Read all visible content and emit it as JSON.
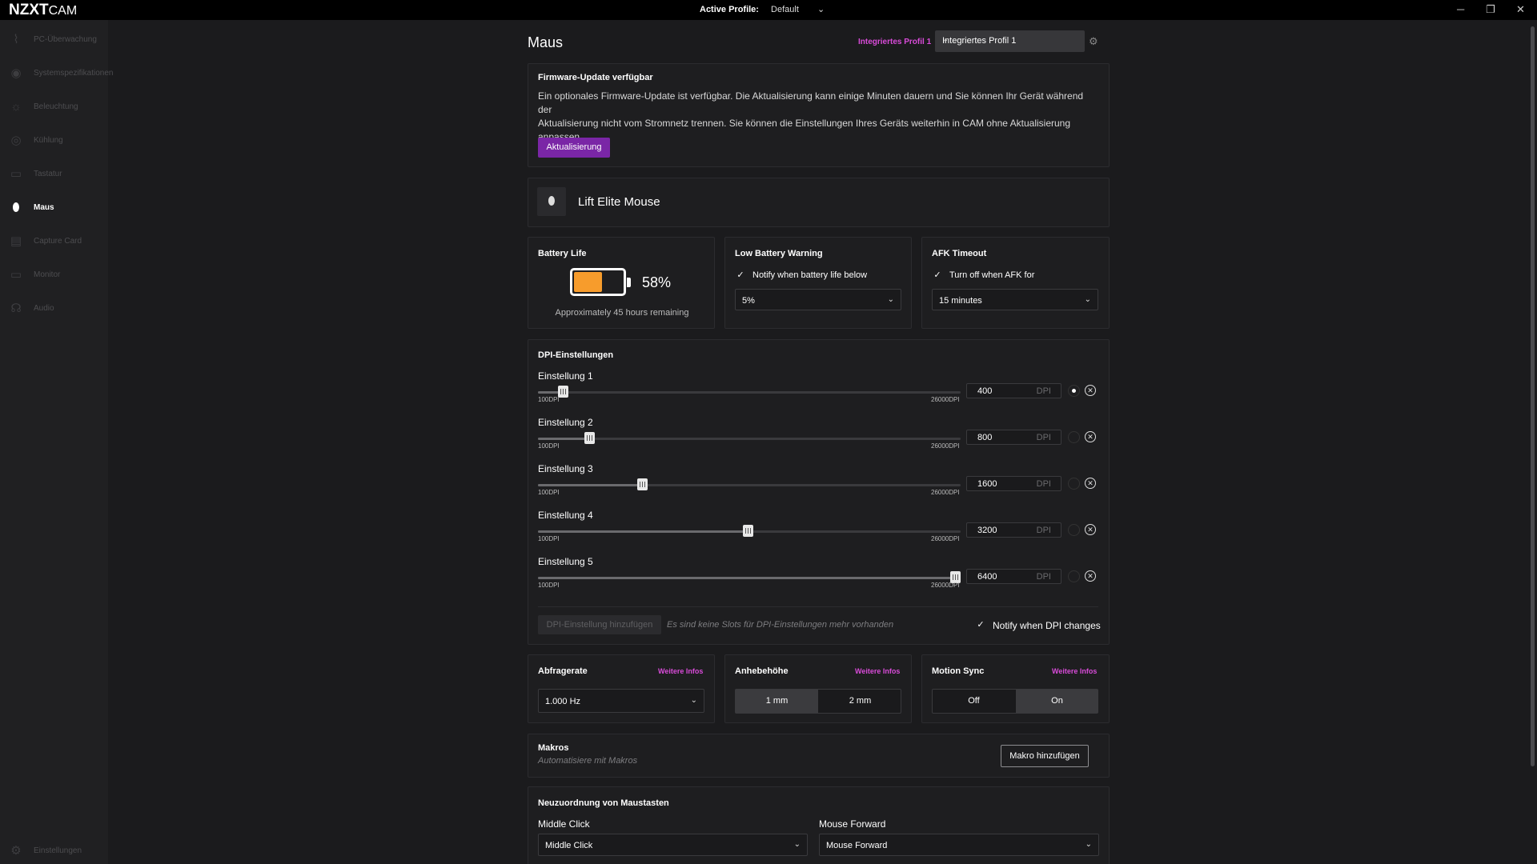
{
  "app": {
    "logo_main": "NZXT",
    "logo_sub": "CAM"
  },
  "titlebar": {
    "active_profile_label": "Active Profile:",
    "active_profile_value": "Default",
    "minimize": "─",
    "maximize": "❐",
    "close": "✕"
  },
  "sidebar": {
    "items": [
      {
        "label": "PC-Überwachung",
        "icon": "chart-line-icon",
        "glyph": "⌇"
      },
      {
        "label": "Systemspezifikationen",
        "icon": "eye-icon",
        "glyph": "◉"
      },
      {
        "label": "Beleuchtung",
        "icon": "sun-icon",
        "glyph": "☼"
      },
      {
        "label": "Kühlung",
        "icon": "fan-icon",
        "glyph": "◎"
      },
      {
        "label": "Tastatur",
        "icon": "keyboard-icon",
        "glyph": "▭"
      },
      {
        "label": "Maus",
        "icon": "mouse-icon",
        "glyph": "⬮"
      },
      {
        "label": "Capture Card",
        "icon": "capture-card-icon",
        "glyph": "▤"
      },
      {
        "label": "Monitor",
        "icon": "monitor-icon",
        "glyph": "▭"
      },
      {
        "label": "Audio",
        "icon": "headset-icon",
        "glyph": "☊"
      }
    ],
    "settings_label": "Einstellungen",
    "settings_glyph": "⚙"
  },
  "header": {
    "title": "Maus",
    "profile_link": "Integriertes Profil 1",
    "profile_select": "Integriertes Profil 1",
    "gear_glyph": "⚙"
  },
  "firmware": {
    "title": "Firmware-Update verfügbar",
    "line1": "Ein optionales Firmware-Update ist verfügbar. Die Aktualisierung kann einige Minuten dauern und Sie können Ihr Gerät während der",
    "line2": "Aktualisierung nicht vom Stromnetz trennen. Sie können die Einstellungen Ihres Geräts weiterhin in CAM ohne Aktualisierung",
    "line3": "anpassen.",
    "button": "Aktualisierung"
  },
  "device": {
    "name": "Lift Elite Mouse",
    "glyph": "⬮"
  },
  "battery": {
    "title": "Battery Life",
    "percent_label": "58%",
    "level": 0.58,
    "remaining": "Approximately 45 hours remaining",
    "color": "#f79c2c"
  },
  "low_battery": {
    "title": "Low Battery Warning",
    "checkbox_label": "Notify when battery life below",
    "value": "5%"
  },
  "afk": {
    "title": "AFK Timeout",
    "checkbox_label": "Turn off when AFK for",
    "value": "15 minutes"
  },
  "dpi": {
    "title": "DPI-Einstellungen",
    "min_label": "100DPI",
    "max_label": "26000DPI",
    "unit": "DPI",
    "min": 100,
    "max": 26000,
    "settings": [
      {
        "label": "Einstellung 1",
        "value": "400",
        "selected": true
      },
      {
        "label": "Einstellung 2",
        "value": "800",
        "selected": false
      },
      {
        "label": "Einstellung 3",
        "value": "1600",
        "selected": false
      },
      {
        "label": "Einstellung 4",
        "value": "3200",
        "selected": false
      },
      {
        "label": "Einstellung 5",
        "value": "6400",
        "selected": false
      }
    ],
    "add_button": "DPI-Einstellung hinzufügen",
    "no_slots_note": "Es sind keine Slots für DPI-Einstellungen mehr vorhanden",
    "notify_label": "Notify when DPI changes"
  },
  "polling": {
    "title": "Abfragerate",
    "more": "Weitere Infos",
    "value": "1.000 Hz"
  },
  "lift_off": {
    "title": "Anhebehöhe",
    "more": "Weitere Infos",
    "options": [
      "1 mm",
      "2 mm"
    ],
    "selected": "1 mm"
  },
  "motion_sync": {
    "title": "Motion Sync",
    "more": "Weitere Infos",
    "options": [
      "Off",
      "On"
    ],
    "selected": "On"
  },
  "macros": {
    "title": "Makros",
    "subtitle": "Automatisiere mit Makros",
    "button": "Makro hinzufügen"
  },
  "remap": {
    "title": "Neuzuordnung von Maustasten",
    "fields": [
      {
        "label": "Middle Click",
        "value": "Middle Click"
      },
      {
        "label": "Mouse Forward",
        "value": "Mouse Forward"
      }
    ]
  },
  "glyphs": {
    "check": "✓",
    "chevron": "⌄",
    "x": "✕"
  }
}
